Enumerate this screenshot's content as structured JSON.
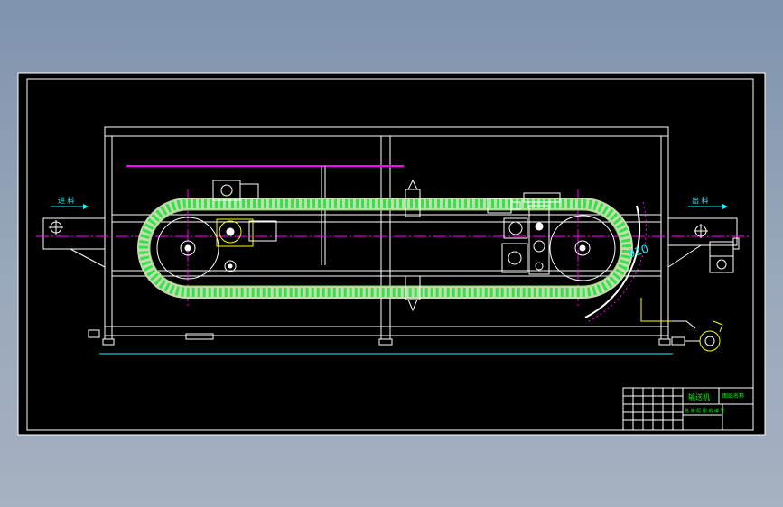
{
  "drawing": {
    "left_label": "进 料",
    "right_label": "出 料",
    "dimension_label": "910"
  },
  "title_block": {
    "part_name": "输送机",
    "company": "图纸名称",
    "drawing_no": "总 装 配 图 纸 编 号 ",
    "small_rows": [
      "",
      "",
      "",
      "",
      ""
    ]
  },
  "colors": {
    "frame": "#ffffff",
    "background": "#000000",
    "chain": "#2ee64a",
    "chain_light": "#c9d9b0",
    "centerline": "#ff00ff",
    "dim": "#00ffff",
    "yellow": "#ffff00",
    "title_green": "#00ff00"
  }
}
